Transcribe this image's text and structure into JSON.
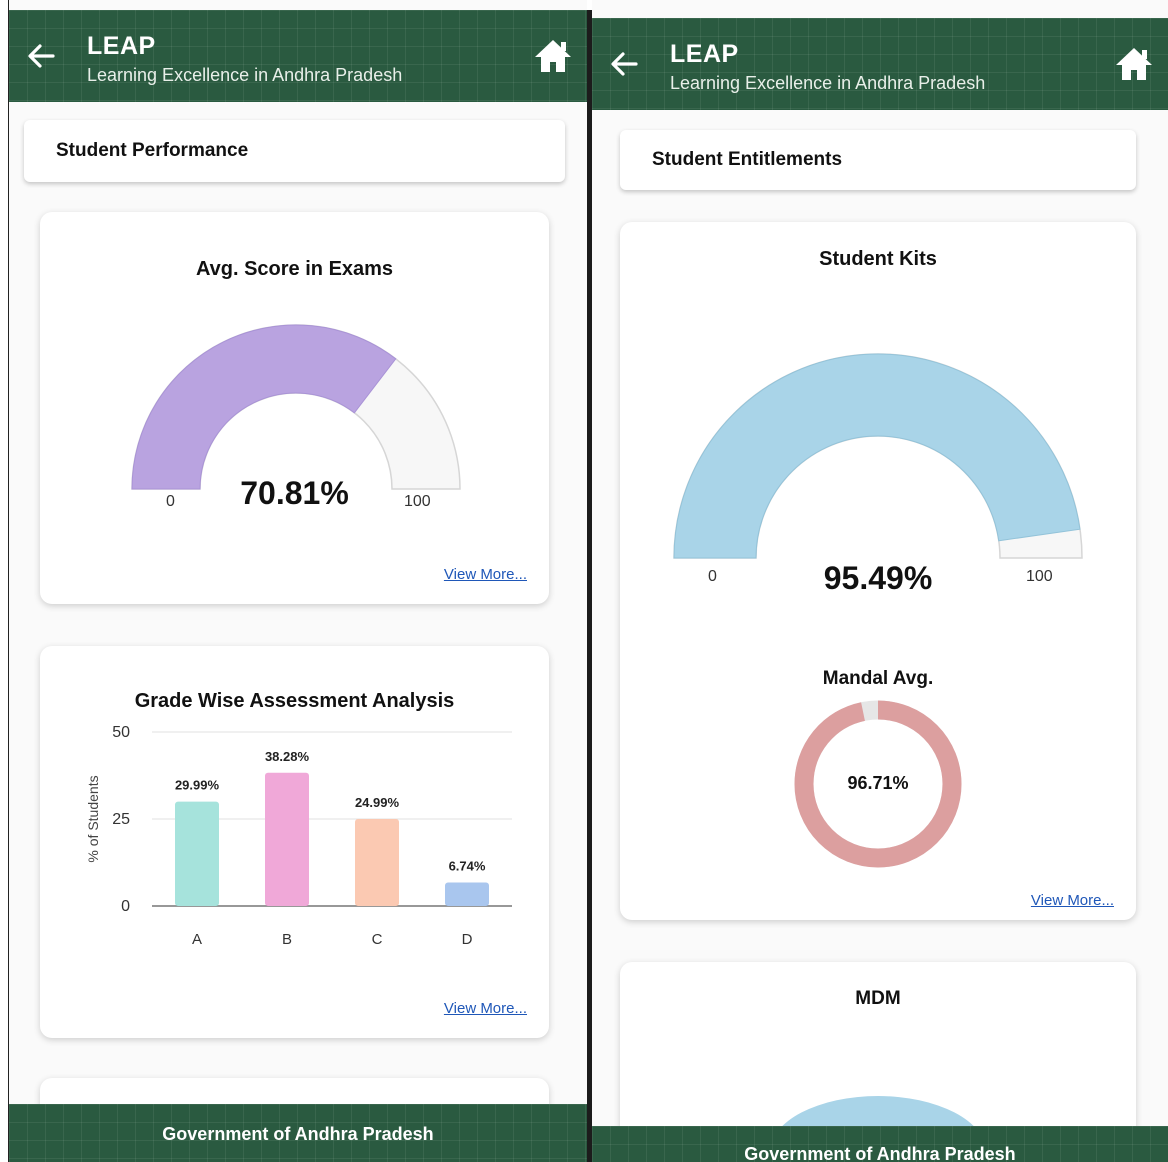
{
  "app": {
    "title": "LEAP",
    "subtitle": "Learning Excellence in Andhra Pradesh",
    "footer": "Government of Andhra Pradesh",
    "brand_color": "#2a5a40"
  },
  "left_screen": {
    "section_title": "Student Performance",
    "score_card": {
      "title": "Avg. Score in Exams",
      "value_text": "70.81%",
      "value": 70.81,
      "min_label": "0",
      "max_label": "100",
      "fill_color": "#b9a3e0",
      "view_more": "View More..."
    },
    "grade_card": {
      "view_more": "View More..."
    }
  },
  "right_screen": {
    "section_title": "Student Entitlements",
    "kits_card": {
      "title": "Student Kits",
      "value_text": "95.49%",
      "value": 95.49,
      "min_label": "0",
      "max_label": "100",
      "fill_color": "#a9d4e8",
      "mandal_label": "Mandal Avg.",
      "mandal_value_text": "96.71%",
      "mandal_value": 96.71,
      "mandal_color": "#dc9f9f",
      "view_more": "View More..."
    },
    "mdm_card": {
      "title": "MDM"
    }
  },
  "chart_data": {
    "type": "bar",
    "title": "Grade Wise Assessment Analysis",
    "xlabel": "",
    "ylabel": "% of Students",
    "categories": [
      "A",
      "B",
      "C",
      "D"
    ],
    "values": [
      29.99,
      38.28,
      24.99,
      6.74
    ],
    "data_labels": [
      "29.99%",
      "38.28%",
      "24.99%",
      "6.74%"
    ],
    "colors": [
      "#a6e3dc",
      "#f0a8d8",
      "#fbc9b2",
      "#a9c6ee"
    ],
    "ylim": [
      0,
      50
    ],
    "yticks": [
      "0",
      "25",
      "50"
    ],
    "grid": true
  }
}
